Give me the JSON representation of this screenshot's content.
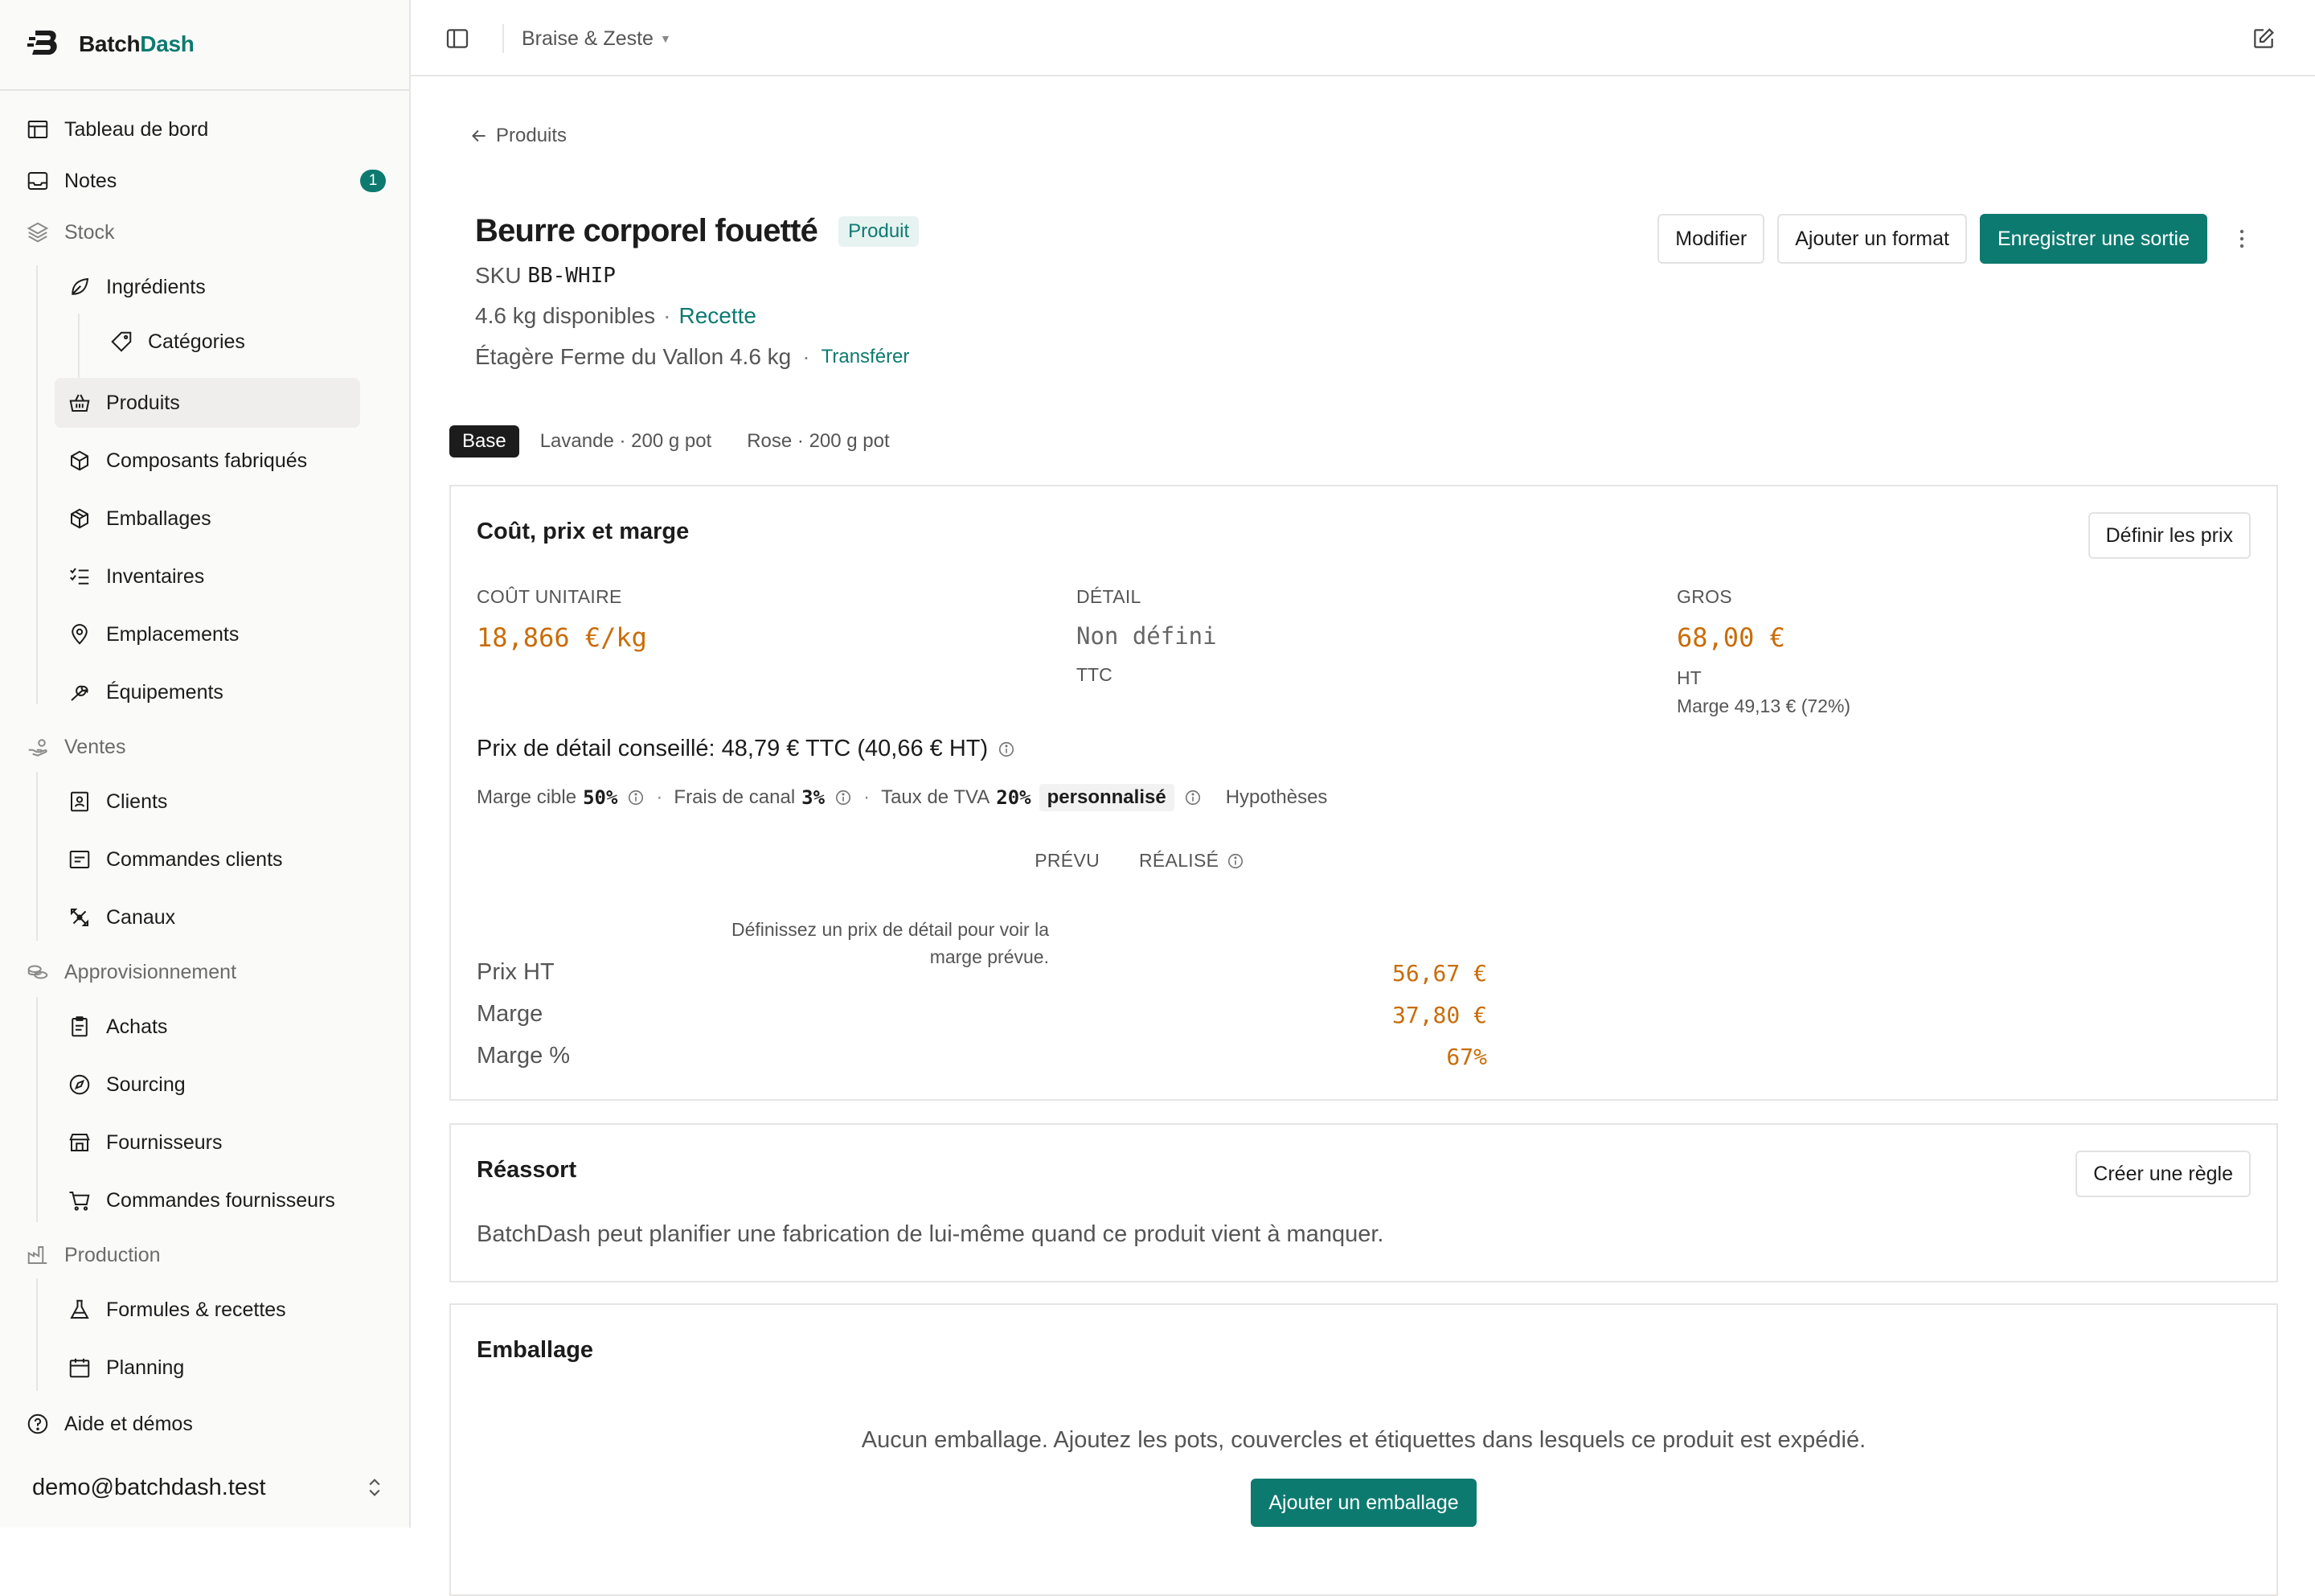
{
  "brand": {
    "name_plain": "Batch",
    "name_accent": "Dash",
    "accent_color": "#0d7a70"
  },
  "sidebar": {
    "items": [
      {
        "label": "Tableau de bord",
        "icon": "layout-icon"
      },
      {
        "label": "Notes",
        "icon": "inbox-icon",
        "badge": "1"
      },
      {
        "label": "Stock",
        "icon": "layers-icon"
      },
      {
        "label": "Ingrédients",
        "icon": "leaf-icon"
      },
      {
        "label": "Catégories",
        "icon": "tag-icon"
      },
      {
        "label": "Produits",
        "icon": "basket-icon"
      },
      {
        "label": "Composants fabriqués",
        "icon": "box-icon"
      },
      {
        "label": "Emballages",
        "icon": "package-icon"
      },
      {
        "label": "Inventaires",
        "icon": "list-checks-icon"
      },
      {
        "label": "Emplacements",
        "icon": "map-pin-icon"
      },
      {
        "label": "Équipements",
        "icon": "wrench-icon"
      },
      {
        "label": "Ventes",
        "icon": "hand-coins-icon"
      },
      {
        "label": "Clients",
        "icon": "contact-icon"
      },
      {
        "label": "Commandes clients",
        "icon": "receipt-icon"
      },
      {
        "label": "Canaux",
        "icon": "satellite-icon"
      },
      {
        "label": "Approvisionnement",
        "icon": "coins-icon"
      },
      {
        "label": "Achats",
        "icon": "clipboard-icon"
      },
      {
        "label": "Sourcing",
        "icon": "compass-icon"
      },
      {
        "label": "Fournisseurs",
        "icon": "store-icon"
      },
      {
        "label": "Commandes fournisseurs",
        "icon": "cart-icon"
      },
      {
        "label": "Production",
        "icon": "factory-icon"
      },
      {
        "label": "Formules & recettes",
        "icon": "flask-icon"
      },
      {
        "label": "Planning",
        "icon": "calendar-icon"
      },
      {
        "label": "Aide et démos",
        "icon": "help-circle-icon"
      }
    ],
    "user_email": "demo@batchdash.test"
  },
  "topbar": {
    "workspace": "Braise & Zeste"
  },
  "page": {
    "back_label": "Produits",
    "title": "Beurre corporel fouetté",
    "type_badge": "Produit",
    "sku_label": "SKU",
    "sku": "BB-WHIP",
    "available": "4.6 kg disponibles",
    "recipe_link": "Recette",
    "shelf": "Étagère Ferme du Vallon 4.6 kg",
    "transfer_link": "Transférer",
    "actions": {
      "edit": "Modifier",
      "add_format": "Ajouter un format",
      "record_exit": "Enregistrer une sortie"
    },
    "variant_tabs": [
      "Base",
      "Lavande · 200 g pot",
      "Rose · 200 g pot"
    ]
  },
  "cost_card": {
    "title": "Coût, prix et marge",
    "set_prices": "Définir les prix",
    "unit_cost": {
      "label": "COÛT UNITAIRE",
      "value": "18,866 €/kg"
    },
    "retail": {
      "label": "DÉTAIL",
      "value": "Non défini",
      "sub": "TTC"
    },
    "wholesale": {
      "label": "GROS",
      "value": "68,00 €",
      "sub": "HT",
      "margin": "Marge 49,13 € (72%)"
    },
    "suggested": "Prix de détail conseillé: 48,79 € TTC (40,66 € HT)",
    "assumptions": {
      "target_margin_label": "Marge cible",
      "target_margin": "50%",
      "channel_fees_label": "Frais de canal",
      "channel_fees": "3%",
      "vat_label": "Taux de TVA",
      "vat": "20%",
      "custom": "personnalisé",
      "hypotheses_link": "Hypothèses"
    },
    "table": {
      "col_planned": "PRÉVU",
      "col_actual": "RÉALISÉ",
      "rows": [
        {
          "label": "Prix HT",
          "actual": "56,67 €"
        },
        {
          "label": "Marge",
          "actual": "37,80 €"
        },
        {
          "label": "Marge %",
          "actual": "67%"
        }
      ],
      "planned_empty": "Définissez un prix de détail pour voir la marge prévue."
    }
  },
  "restock_card": {
    "title": "Réassort",
    "button": "Créer une règle",
    "text": "BatchDash peut planifier une fabrication de lui-même quand ce produit vient à manquer."
  },
  "packaging_card": {
    "title": "Emballage",
    "empty": "Aucun emballage. Ajoutez les pots, couvercles et étiquettes dans lesquels ce produit est expédié.",
    "button": "Ajouter un emballage"
  }
}
